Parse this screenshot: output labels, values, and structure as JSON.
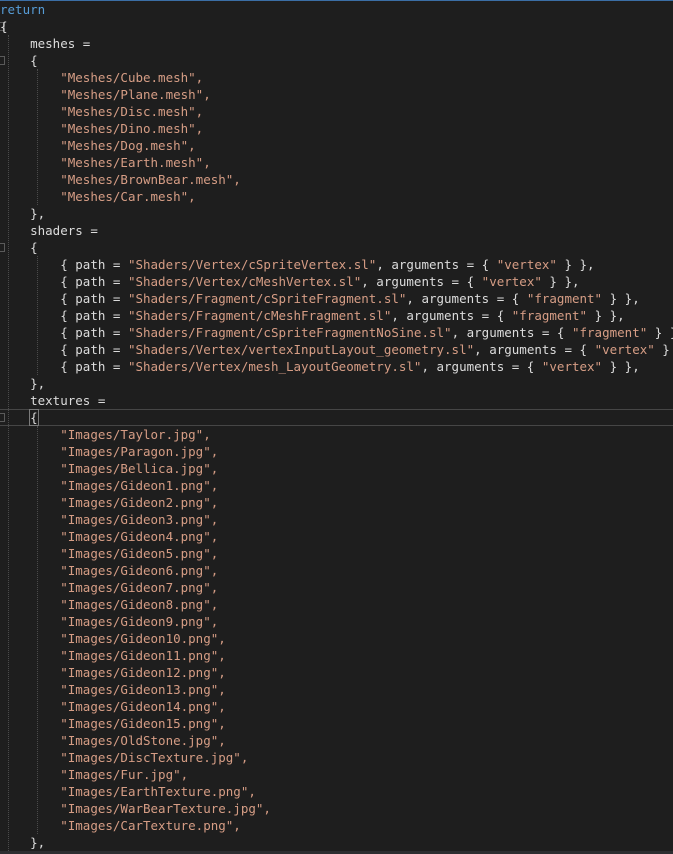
{
  "editor": {
    "keyword_return": "return",
    "open_brace": "{",
    "meshes_key": "meshes =",
    "shaders_key": "shaders =",
    "textures_key": "textures =",
    "block_open": "{",
    "block_close": "},",
    "meshes": [
      "\"Meshes/Cube.mesh\",",
      "\"Meshes/Plane.mesh\",",
      "\"Meshes/Disc.mesh\",",
      "\"Meshes/Dino.mesh\",",
      "\"Meshes/Dog.mesh\",",
      "\"Meshes/Earth.mesh\",",
      "\"Meshes/BrownBear.mesh\",",
      "\"Meshes/Car.mesh\","
    ],
    "shaders": [
      {
        "path": "\"Shaders/Vertex/cSpriteVertex.sl\"",
        "arg": "\"vertex\""
      },
      {
        "path": "\"Shaders/Vertex/cMeshVertex.sl\"",
        "arg": "\"vertex\""
      },
      {
        "path": "\"Shaders/Fragment/cSpriteFragment.sl\"",
        "arg": "\"fragment\""
      },
      {
        "path": "\"Shaders/Fragment/cMeshFragment.sl\"",
        "arg": "\"fragment\""
      },
      {
        "path": "\"Shaders/Fragment/cSpriteFragmentNoSine.sl\"",
        "arg": "\"fragment\""
      },
      {
        "path": "\"Shaders/Vertex/vertexInputLayout_geometry.sl\"",
        "arg": "\"vertex\""
      },
      {
        "path": "\"Shaders/Vertex/mesh_LayoutGeometry.sl\"",
        "arg": "\"vertex\""
      }
    ],
    "textures": [
      "\"Images/Taylor.jpg\",",
      "\"Images/Paragon.jpg\",",
      "\"Images/Bellica.jpg\",",
      "\"Images/Gideon1.png\",",
      "\"Images/Gideon2.png\",",
      "\"Images/Gideon3.png\",",
      "\"Images/Gideon4.png\",",
      "\"Images/Gideon5.png\",",
      "\"Images/Gideon6.png\",",
      "\"Images/Gideon7.png\",",
      "\"Images/Gideon8.png\",",
      "\"Images/Gideon9.png\",",
      "\"Images/Gideon10.png\",",
      "\"Images/Gideon11.png\",",
      "\"Images/Gideon12.png\",",
      "\"Images/Gideon13.png\",",
      "\"Images/Gideon14.png\",",
      "\"Images/Gideon15.png\",",
      "\"Images/OldStone.jpg\",",
      "\"Images/DiscTexture.jpg\",",
      "\"Images/Fur.jpg\",",
      "\"Images/EarthTexture.png\",",
      "\"Images/WarBearTexture.jpg\",",
      "\"Images/CarTexture.png\","
    ],
    "colors": {
      "background": "#1e1e1e",
      "keyword": "#569cd6",
      "string": "#d69d85",
      "identifier": "#dcdcdc"
    }
  }
}
